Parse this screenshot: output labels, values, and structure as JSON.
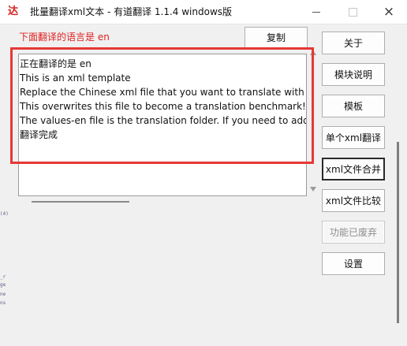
{
  "window": {
    "title": "批量翻译xml文本 - 有道翻译 1.1.4 windows版",
    "app_icon_text": "达",
    "controls": {
      "minimize": "minimize-icon",
      "maximize": "maximize-icon",
      "close": "×"
    }
  },
  "main": {
    "language_label": "下面翻译的语言是 en",
    "copy_button": "复制",
    "output_lines": [
      "正在翻译的是 en",
      "This is an xml template",
      "Replace the Chinese xml file that you want to translate with stri",
      "This overwrites this file to become a translation benchmark!!",
      "The values-en file is the translation folder. If you need to add a",
      "翻译完成"
    ]
  },
  "sidebar": {
    "buttons": [
      {
        "label": "关于",
        "enabled": true
      },
      {
        "label": "模块说明",
        "enabled": true
      },
      {
        "label": "模板",
        "enabled": true
      },
      {
        "label": "单个xml翻译",
        "enabled": true
      },
      {
        "label": "xml文件合并",
        "enabled": true
      },
      {
        "label": "xml文件比较",
        "enabled": true
      },
      {
        "label": "功能已废弃",
        "enabled": false
      },
      {
        "label": "设置",
        "enabled": true
      }
    ]
  },
  "colors": {
    "language_label": "#e02020",
    "highlight_border": "#e53935",
    "window_bg": "#f0f0f0"
  },
  "background_fragments": {
    "left_edge": [
      "(4)",
      "_r",
      "ge",
      "ne",
      "ns"
    ]
  }
}
